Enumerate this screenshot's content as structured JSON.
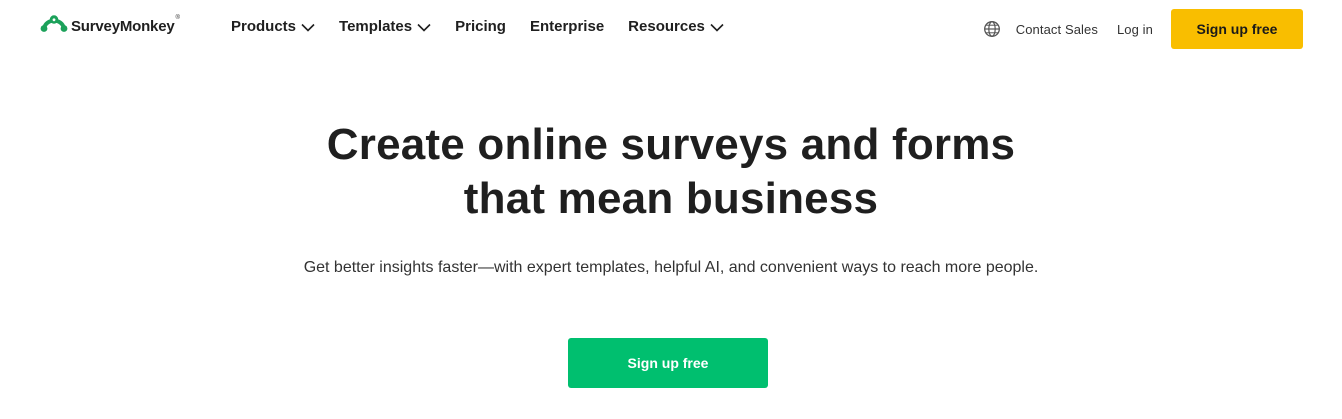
{
  "brand": {
    "name": "SurveyMonkey",
    "trademark": "®",
    "logo_icon": "surveymonkey-logo-icon",
    "colors": {
      "brand_green": "#00bf6f",
      "logo_green": "#1ca15a",
      "signup_yellow": "#f9be00",
      "text_dark": "#1f1f1f"
    }
  },
  "nav": {
    "items": [
      {
        "label": "Products",
        "has_dropdown": true
      },
      {
        "label": "Templates",
        "has_dropdown": true
      },
      {
        "label": "Pricing",
        "has_dropdown": false
      },
      {
        "label": "Enterprise",
        "has_dropdown": false
      },
      {
        "label": "Resources",
        "has_dropdown": true
      }
    ],
    "dropdown_icon": "chevron-down-icon"
  },
  "utility": {
    "language_icon": "globe-icon",
    "contact_sales": "Contact Sales",
    "login": "Log in",
    "signup": "Sign up free"
  },
  "hero": {
    "title_line1": "Create online surveys and forms",
    "title_line2": "that mean business",
    "subtitle": "Get better insights faster—with expert templates, helpful AI, and convenient ways to reach more people.",
    "cta": "Sign up free"
  }
}
